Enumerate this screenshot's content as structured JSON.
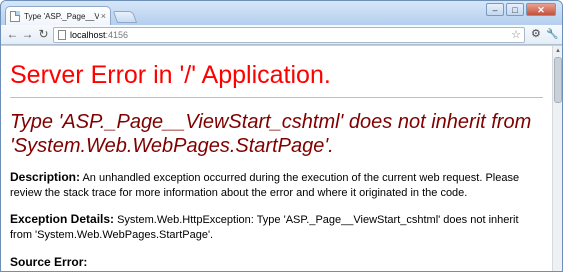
{
  "tab": {
    "title": "Type 'ASP._Page__ViewSta",
    "close": "×"
  },
  "window_controls": {
    "minimize": "–",
    "maximize": "□",
    "close": "✕"
  },
  "toolbar": {
    "back": "←",
    "forward": "→",
    "reload": "↻",
    "url_host": "localhost",
    "url_port": ":4156",
    "star": "☆",
    "page_menu": "⚙",
    "wrench_menu": "🔧"
  },
  "page": {
    "heading": "Server Error in '/' Application.",
    "error_title": "Type 'ASP._Page__ViewStart_cshtml' does not inherit from 'System.Web.WebPages.StartPage'.",
    "description_label": "Description:",
    "description_text": " An unhandled exception occurred during the execution of the current web request. Please review the stack trace for more information about the error and where it originated in the code.",
    "exception_label": "Exception Details:",
    "exception_text": " System.Web.HttpException: Type 'ASP._Page__ViewStart_cshtml' does not inherit from 'System.Web.WebPages.StartPage'.",
    "source_error_label": "Source Error:"
  },
  "scrollbar": {
    "up": "▲"
  }
}
